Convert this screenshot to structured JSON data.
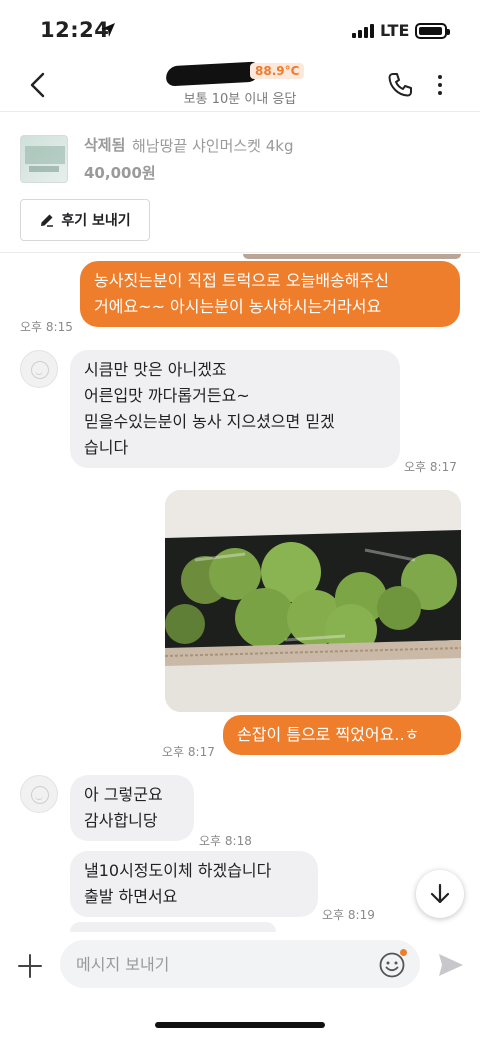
{
  "status_bar": {
    "time": "12:24",
    "network": "LTE"
  },
  "header": {
    "user_name": "",
    "manner_temperature": "88.9°C",
    "response_time": "보통 10분 이내 응답",
    "back_icon": "chevron-left-icon",
    "call_icon": "phone-icon",
    "more_icon": "more-vertical-icon"
  },
  "product": {
    "status": "삭제됨",
    "title": "해남땅끝 샤인머스켓 4kg",
    "price": "40,000원",
    "review_button_label": "후기 보내기",
    "review_icon": "pencil-icon"
  },
  "messages": [
    {
      "sender": "me",
      "lines": [
        "농사짓는분이 직접 트럭으로 오늘배송해주신",
        "거에요~~ 아시는분이 농사하시는거라서요"
      ],
      "time": "오후 8:15"
    },
    {
      "sender": "them",
      "lines": [
        "시큼만 맛은 아니겠죠",
        "어른입맛 까다롭거든요~",
        "믿을수있는분이 농사 지으셨으면 믿겠",
        "습니다"
      ],
      "time": "오후 8:17"
    },
    {
      "sender": "me",
      "type": "image",
      "image_description": "photo of green shine muscat grapes in a box"
    },
    {
      "sender": "me",
      "lines": [
        "손잡이 틈으로 찍었어요..ㅎ"
      ],
      "time": "오후 8:17"
    },
    {
      "sender": "them",
      "lines": [
        "아 그렇군요",
        "감사합니당"
      ],
      "time": "오후 8:18"
    },
    {
      "sender": "them",
      "lines": [
        "낼10시정도이체 하겠습니다",
        "출발 하면서요"
      ],
      "time": "오후 8:19"
    }
  ],
  "input": {
    "placeholder": "메시지 보내기"
  },
  "colors": {
    "accent": "#ef7e2c",
    "incoming_bubble": "#f0f0f2",
    "temperature_badge_bg": "#fde9dc"
  }
}
